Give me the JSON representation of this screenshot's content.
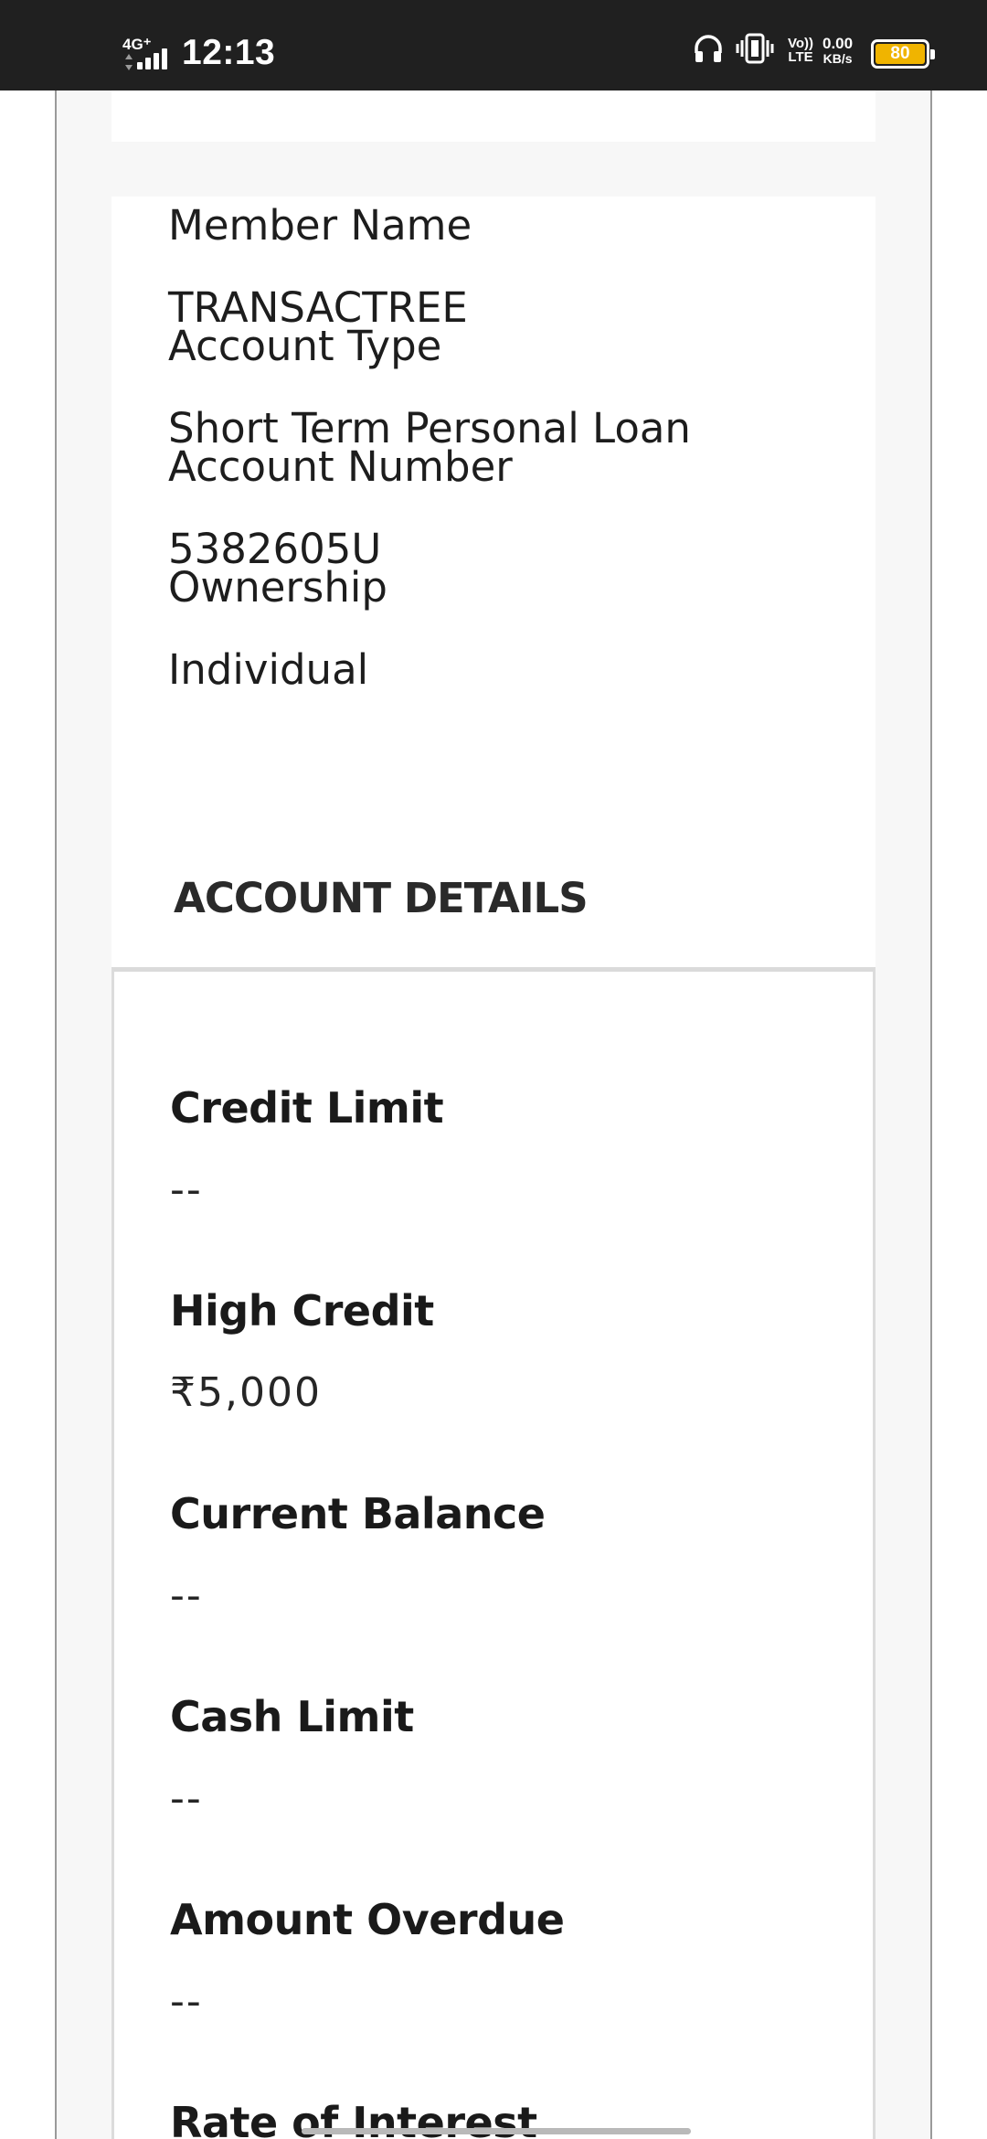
{
  "status_bar": {
    "network": "4G⁺",
    "time": "12:13",
    "volte_line1": "Vo))",
    "volte_line2": "LTE",
    "speed_value": "0.00",
    "speed_unit": "KB/s",
    "battery": "80"
  },
  "account_info": [
    {
      "label": "Member Name",
      "value": "TRANSACTREE"
    },
    {
      "label": "Account Type",
      "value": "Short Term Personal Loan"
    },
    {
      "label": "Account Number",
      "value": "5382605U"
    },
    {
      "label": "Ownership",
      "value": "Individual"
    }
  ],
  "section_title": "ACCOUNT DETAILS",
  "details": [
    {
      "label": "Credit Limit",
      "value": "--"
    },
    {
      "label": "High Credit",
      "value": "₹5,000"
    },
    {
      "label": "Current Balance",
      "value": "--"
    },
    {
      "label": "Cash Limit",
      "value": "--"
    },
    {
      "label": "Amount Overdue",
      "value": "--"
    },
    {
      "label": "Rate of Interest",
      "value": ""
    }
  ],
  "colors": {
    "status_bar_bg": "#202020",
    "battery": "#f0b400",
    "page_bg": "#f7f7f7",
    "card_bg": "#ffffff"
  },
  "icons": {
    "headphone": "headphone-icon",
    "vibrate": "vibrate-icon",
    "signal": "signal-icon",
    "battery": "battery-icon"
  }
}
